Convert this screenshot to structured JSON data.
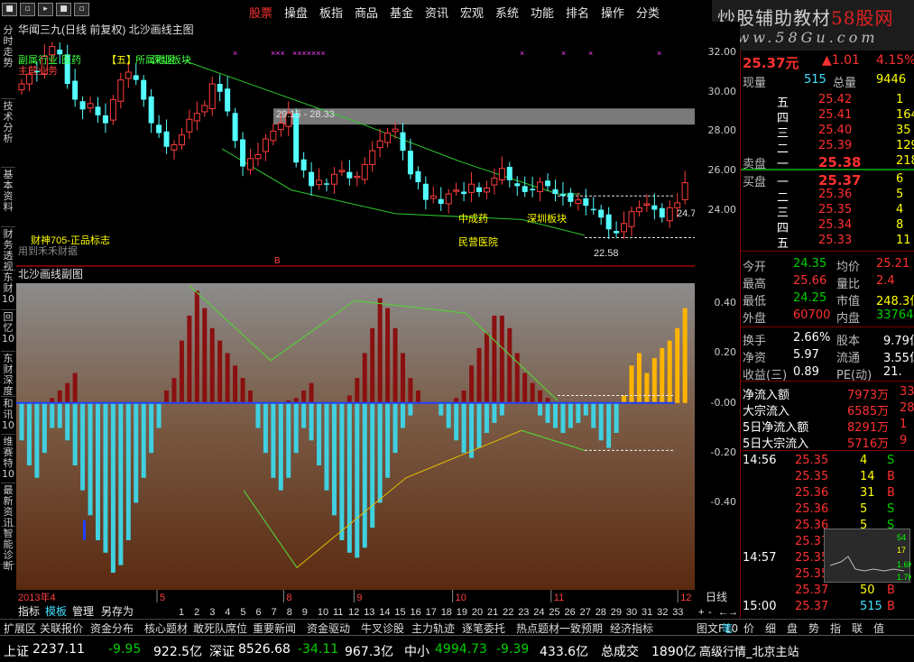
{
  "menu": {
    "system_buttons": [
      "■",
      "▫",
      "▸",
      "■",
      "▫"
    ],
    "items": [
      "股票",
      "操盘",
      "板指",
      "商品",
      "基金",
      "资讯",
      "宏观",
      "系统",
      "功能",
      "排名",
      "操作",
      "分类"
    ],
    "active": "股票"
  },
  "logo": {
    "line1_a": "炒股辅助教材",
    "line1_b": "58股网",
    "line2": "www.58Gu.com"
  },
  "left_tabs": [
    "分时走势",
    "技术分析",
    "基本资料",
    "财务透视",
    "东财10",
    "回忆10",
    "东财深度",
    "和讯10",
    "维赛特10",
    "最新资讯",
    "智能诊断"
  ],
  "main_chart": {
    "title": "华闻三九(日线 前复权) 北沙画线主图",
    "sector_labels": [
      "副属行业",
      "医药",
      "【五】",
      "所属地区",
      "深圳板块"
    ],
    "side_label": "主营业务",
    "annotations": [
      {
        "text": "29.15 - 28.33",
        "color": "#e0e0e0"
      },
      {
        "text": "中成药",
        "color": "#ffff00"
      },
      {
        "text": "深圳板块",
        "color": "#ffff00"
      },
      {
        "text": "民营医院",
        "color": "#ffff00"
      },
      {
        "text": "财神705-正品标志",
        "color": "#ffff00"
      },
      {
        "text": "用到禾禾财据",
        "color": "#888888"
      },
      {
        "text": "22.58",
        "color": "#e0e0e0"
      },
      {
        "text": "24.7",
        "color": "#e0e0e0"
      }
    ],
    "markers": [
      "×",
      "×××",
      "×××××××",
      "×",
      "×",
      "×",
      "×"
    ],
    "y_ticks": [
      32,
      30,
      28,
      26,
      24
    ],
    "price_min": 21.5,
    "price_max": 33.2,
    "up_color": "#ff3c3c",
    "down_color": "#54ffff"
  },
  "sub_chart": {
    "title": "北沙画线副图",
    "y_ticks": [
      0.4,
      0.2,
      -0.0,
      -0.2,
      -0.4
    ],
    "y_tick_labels": [
      "0.40",
      "0.20",
      "-0.00",
      "-0.20",
      "-0.40"
    ],
    "val_min": -0.72,
    "val_max": 0.48
  },
  "x_axis": {
    "year_label": "2013年4",
    "month_labels": [
      {
        "text": "5",
        "i": 10
      },
      {
        "text": "8",
        "i": 19
      },
      {
        "text": "9",
        "i": 24
      },
      {
        "text": "10",
        "i": 31
      },
      {
        "text": "11",
        "i": 38
      },
      {
        "text": "12",
        "i": 47
      }
    ],
    "day_labels": [
      "1",
      "2",
      "3",
      "4",
      "5",
      "6",
      "7",
      "8",
      "9",
      "10",
      "11",
      "12",
      "13",
      "14",
      "15",
      "16",
      "17",
      "18",
      "19",
      "20",
      "21",
      "22",
      "23",
      "24",
      "25",
      "26",
      "27",
      "28",
      "29",
      "30",
      "31",
      "32",
      "33"
    ],
    "period_label": "日线"
  },
  "bottom_tabs": [
    "指标",
    "模板",
    "管理",
    "另存为"
  ],
  "quote": {
    "price": "25.37元",
    "change": "▲1.01",
    "pct": "4.15%",
    "xianliang_label": "现量",
    "xianliang": "515",
    "zongliang_label": "总量",
    "zongliang": "9446",
    "sell_levels": [
      {
        "label": "五",
        "price": "25.42",
        "vol": "1"
      },
      {
        "label": "四",
        "price": "25.41",
        "vol": "164"
      },
      {
        "label": "三",
        "price": "25.40",
        "vol": "35"
      },
      {
        "label": "二",
        "price": "25.39",
        "vol": "129"
      },
      {
        "label": "一",
        "price": "25.38",
        "vol": "218"
      }
    ],
    "sell_label": "卖盘",
    "buy_label": "买盘",
    "buy_levels": [
      {
        "label": "一",
        "price": "25.37",
        "vol": "6"
      },
      {
        "label": "二",
        "price": "25.36",
        "vol": "5"
      },
      {
        "label": "三",
        "price": "25.35",
        "vol": "4"
      },
      {
        "label": "四",
        "price": "25.34",
        "vol": "8"
      },
      {
        "label": "五",
        "price": "25.33",
        "vol": "11"
      }
    ],
    "stats": [
      {
        "l1": "今开",
        "v1": "24.35",
        "l2": "均价",
        "v2": "25.21"
      },
      {
        "l1": "最高",
        "v1": "25.66",
        "l2": "量比",
        "v2": "2.4"
      },
      {
        "l1": "最低",
        "v1": "24.25",
        "l2": "市值",
        "v2": "248.3亿"
      },
      {
        "l1": "外盘",
        "v1": "60700",
        "l2": "内盘",
        "v2": "33764"
      }
    ],
    "stats2": [
      {
        "l1": "换手",
        "v1": "2.66%",
        "l2": "股本",
        "v2": "9.79亿"
      },
      {
        "l1": "净资",
        "v1": "5.97",
        "l2": "流通",
        "v2": "3.55亿"
      },
      {
        "l1": "收益(三)",
        "v1": "0.89",
        "l2": "PE(动)",
        "v2": "21."
      }
    ],
    "flows": [
      {
        "l": "净流入额",
        "v": "7973万",
        "e": "33"
      },
      {
        "l": "大宗流入",
        "v": "6585万",
        "e": "28"
      },
      {
        "l": "5日净流入额",
        "v": "8291万",
        "e": "1"
      },
      {
        "l": "5日大宗流入",
        "v": "5716万",
        "e": "9"
      }
    ],
    "ticks": [
      {
        "t": "14:56",
        "p": "25.35",
        "v": "4",
        "s": "S"
      },
      {
        "t": "",
        "p": "25.35",
        "v": "14",
        "s": "B"
      },
      {
        "t": "",
        "p": "25.36",
        "v": "31",
        "s": "B"
      },
      {
        "t": "",
        "p": "25.36",
        "v": "5",
        "s": "S"
      },
      {
        "t": "",
        "p": "25.36",
        "v": "5",
        "s": "S"
      },
      {
        "t": "",
        "p": "25.37",
        "v": "29",
        "s": "S"
      },
      {
        "t": "14:57",
        "p": "25.35",
        "v": "39",
        "s": "S"
      },
      {
        "t": "",
        "p": "25.35",
        "v": "52",
        "s": "B"
      },
      {
        "t": "",
        "p": "25.37",
        "v": "50",
        "s": "B"
      },
      {
        "t": "15:00",
        "p": "25.37",
        "v": "515",
        "s": "B"
      }
    ],
    "mini_chart": {
      "a": "54",
      "b": "17",
      "c": "1.6K",
      "d": "1.7K"
    }
  },
  "right_tabs": [
    "图文F10",
    "笔",
    "价",
    "细",
    "盘",
    "势",
    "指",
    "联",
    "值",
    "主"
  ],
  "func_tabs": [
    "扩展区",
    "关联报价",
    "资金分布",
    "核心题材",
    "敢死队席位",
    "重要新闻",
    "资金驱动",
    "牛叉诊股",
    "主力轨迹",
    "逐笔委托",
    "热点题材",
    "一致预期",
    "经济指标"
  ],
  "status": {
    "sh_label": "上证",
    "sh_val": "2237.11",
    "sh_chg": "-9.95",
    "sh_amt": "922.5亿",
    "sz_label": "深证",
    "sz_val": "8526.68",
    "sz_chg": "-34.11",
    "sz_amt": "967.3亿",
    "zx_label": "中小",
    "zx_val": "4994.73",
    "zx_chg": "-9.39",
    "zx_amt": "433.6亿",
    "total_label": "总成交",
    "total_val": "1890亿",
    "feed": "高级行情_北京主站"
  }
}
